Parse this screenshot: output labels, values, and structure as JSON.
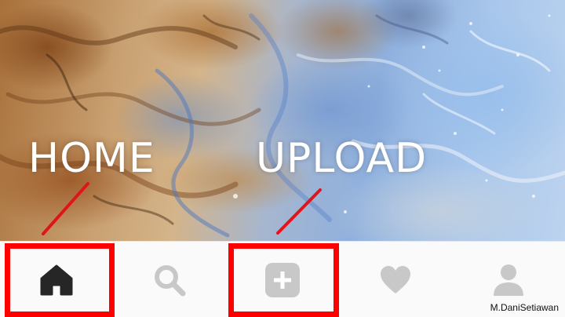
{
  "annotations": {
    "home_label": "HOME",
    "upload_label": "UPLOAD",
    "arrow_color": "#e0151b",
    "box_color": "#ff0000"
  },
  "navbar": {
    "items": [
      {
        "id": "home",
        "icon": "home-icon",
        "active": true
      },
      {
        "id": "search",
        "icon": "search-icon",
        "active": false
      },
      {
        "id": "upload",
        "icon": "plus-square-icon",
        "active": false
      },
      {
        "id": "likes",
        "icon": "heart-icon",
        "active": false
      },
      {
        "id": "profile",
        "icon": "person-icon",
        "active": false
      }
    ],
    "active_color": "#262626",
    "inactive_color": "#c8c8c8"
  },
  "watermark": "M.DaniSetiawan"
}
